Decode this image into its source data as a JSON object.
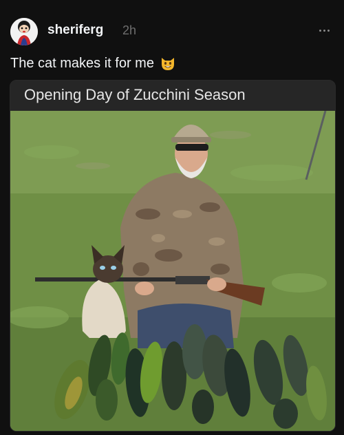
{
  "post": {
    "username": "sheriferg",
    "timestamp": "2h",
    "caption": "The cat makes it for me",
    "caption_emoji": "grinning-cat-emoji",
    "more_icon": "more-dots-icon"
  },
  "media": {
    "meme_title": "Opening Day of Zucchini Season"
  },
  "colors": {
    "background": "#101010",
    "text_primary": "#f3f5f7",
    "text_secondary": "#6f6f6f",
    "grass": "#7a9a4a"
  }
}
